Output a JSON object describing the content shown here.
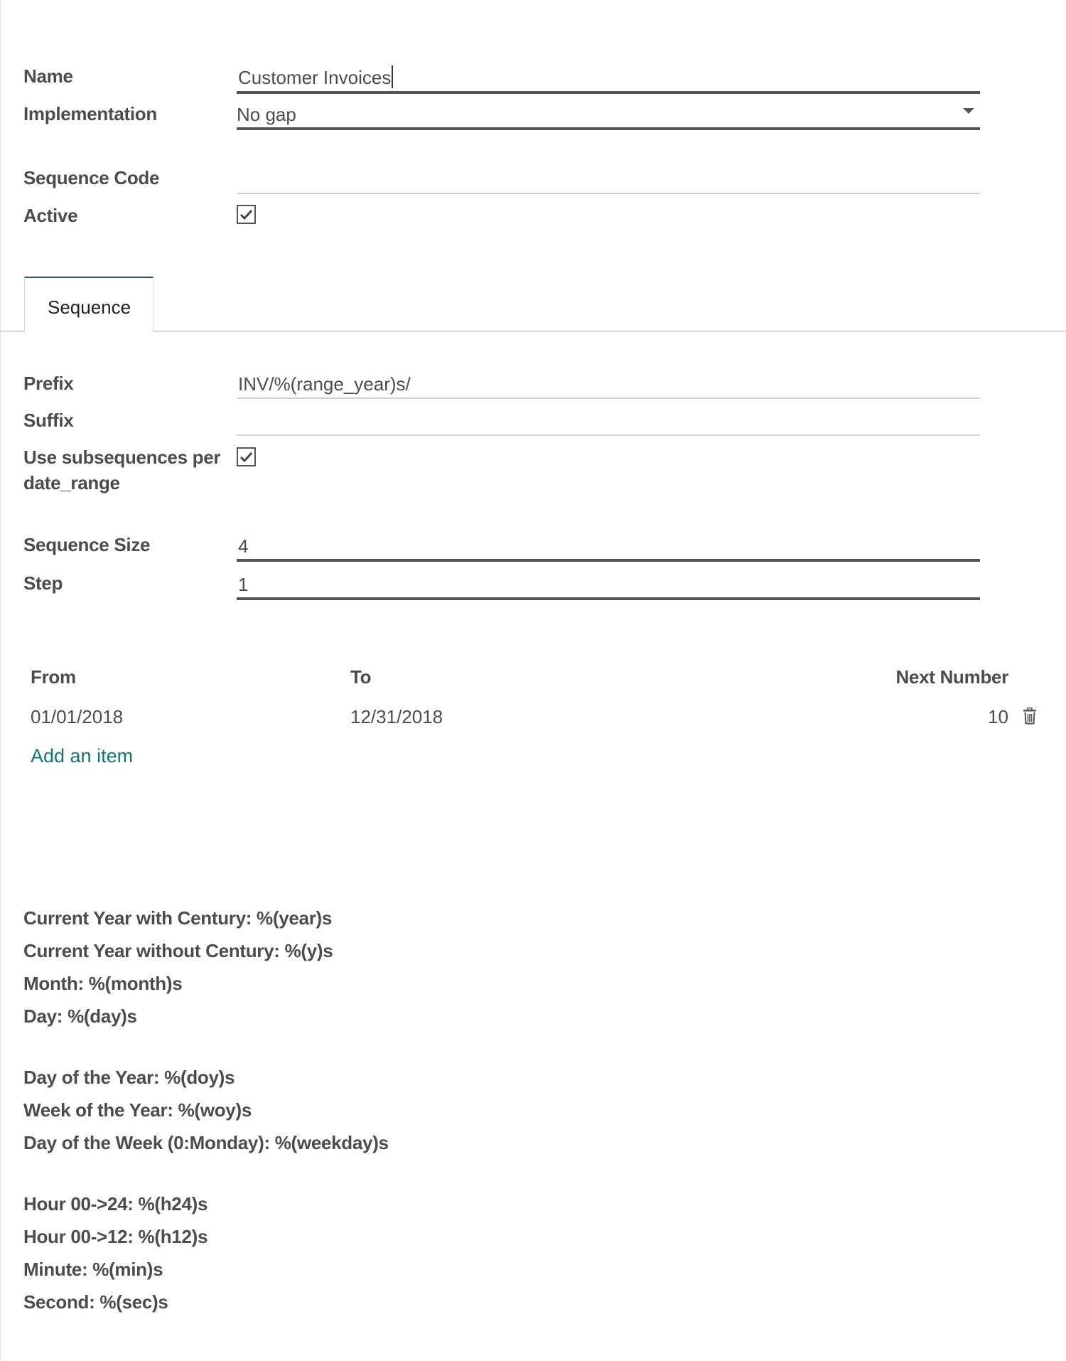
{
  "form": {
    "name_label": "Name",
    "name_value": "Customer Invoices",
    "implementation_label": "Implementation",
    "implementation_value": "No gap",
    "sequence_code_label": "Sequence Code",
    "sequence_code_value": "",
    "active_label": "Active",
    "active_checked": true
  },
  "tabs": [
    {
      "label": "Sequence",
      "active": true
    }
  ],
  "sequence": {
    "prefix_label": "Prefix",
    "prefix_value": "INV/%(range_year)s/",
    "suffix_label": "Suffix",
    "suffix_value": "",
    "subseq_label_line1": "Use subsequences per",
    "subseq_label_line2": "date_range",
    "subseq_checked": true,
    "size_label": "Sequence Size",
    "size_value": "4",
    "step_label": "Step",
    "step_value": "1"
  },
  "table": {
    "headers": {
      "from": "From",
      "to": "To",
      "next": "Next Number"
    },
    "rows": [
      {
        "from": "01/01/2018",
        "to": "12/31/2018",
        "next": "10"
      }
    ],
    "add_item": "Add an item",
    "delete_icon": "trash-icon"
  },
  "legend": {
    "group1": [
      "Current Year with Century: %(year)s",
      "Current Year without Century: %(y)s",
      "Month: %(month)s",
      "Day: %(day)s"
    ],
    "group2": [
      "Day of the Year: %(doy)s",
      "Week of the Year: %(woy)s",
      "Day of the Week (0:Monday): %(weekday)s"
    ],
    "group3": [
      "Hour 00->24: %(h24)s",
      "Hour 00->12: %(h12)s",
      "Minute: %(min)s",
      "Second: %(sec)s"
    ]
  },
  "colors": {
    "link": "#0e7674",
    "tab_accent": "#24506b",
    "text": "#4c4c4c"
  }
}
